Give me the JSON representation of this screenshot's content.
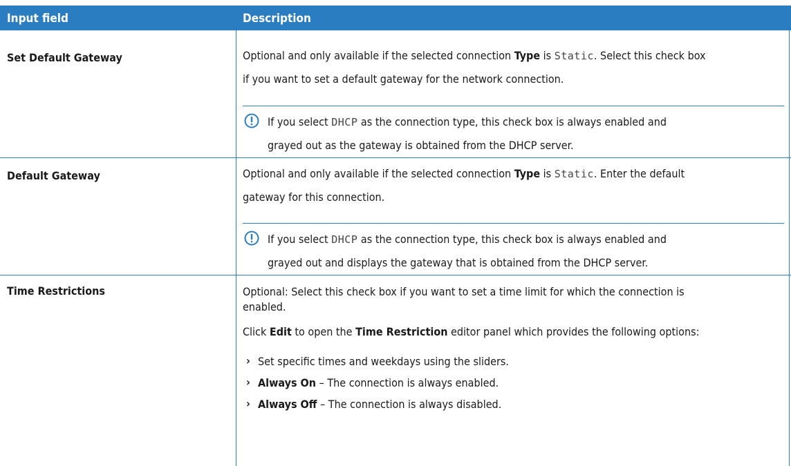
{
  "header": {
    "col1": "Input field",
    "col2": "Description"
  },
  "rows": [
    {
      "field": "Set Default Gateway",
      "desc": {
        "pre": "Optional and only available if the selected connection ",
        "type_bold": "Type",
        "is": " is ",
        "static_mono": "Static",
        "post": ". Select this check box",
        "line2": "if you want to set a default gateway for the network connection."
      },
      "note": {
        "icon": "exclamation-circle-icon",
        "pre": "If you select ",
        "dhcp_mono": "DHCP",
        "post": " as the connection type, this check box is always enabled and",
        "line2": "grayed out as the gateway is obtained from the DHCP server."
      }
    },
    {
      "field": "Default Gateway",
      "desc": {
        "pre": "Optional and only available if the selected connection ",
        "type_bold": "Type",
        "is": " is ",
        "static_mono": "Static",
        "post": ". Enter the default",
        "line2": "gateway for this connection."
      },
      "note": {
        "icon": "exclamation-circle-icon",
        "pre": "If you select ",
        "dhcp_mono": "DHCP",
        "post": " as the connection type, this check box is always enabled and",
        "line2": "grayed out and displays the gateway that is obtained from the DHCP server."
      }
    },
    {
      "field": "Time Restrictions",
      "desc": {
        "p1_line1": "Optional: Select this check box if you want to set a time limit for which the connection is",
        "p1_line2": "enabled.",
        "p2_pre": "Click ",
        "p2_edit": "Edit",
        "p2_mid": " to open the ",
        "p2_tr": "Time Restriction",
        "p2_post": " editor panel which provides the following options:"
      },
      "bullets": [
        {
          "icon": "chevron-right-icon",
          "bold": "",
          "text": "Set specific times and weekdays using the sliders."
        },
        {
          "icon": "chevron-right-icon",
          "bold": "Always On",
          "text": " – The connection is always enabled."
        },
        {
          "icon": "chevron-right-icon",
          "bold": "Always Off",
          "text": " – The connection is always disabled."
        }
      ]
    }
  ],
  "colors": {
    "header_bg": "#2b7dc1",
    "rule": "#2b7dc1",
    "header_text": "#ffffff"
  }
}
